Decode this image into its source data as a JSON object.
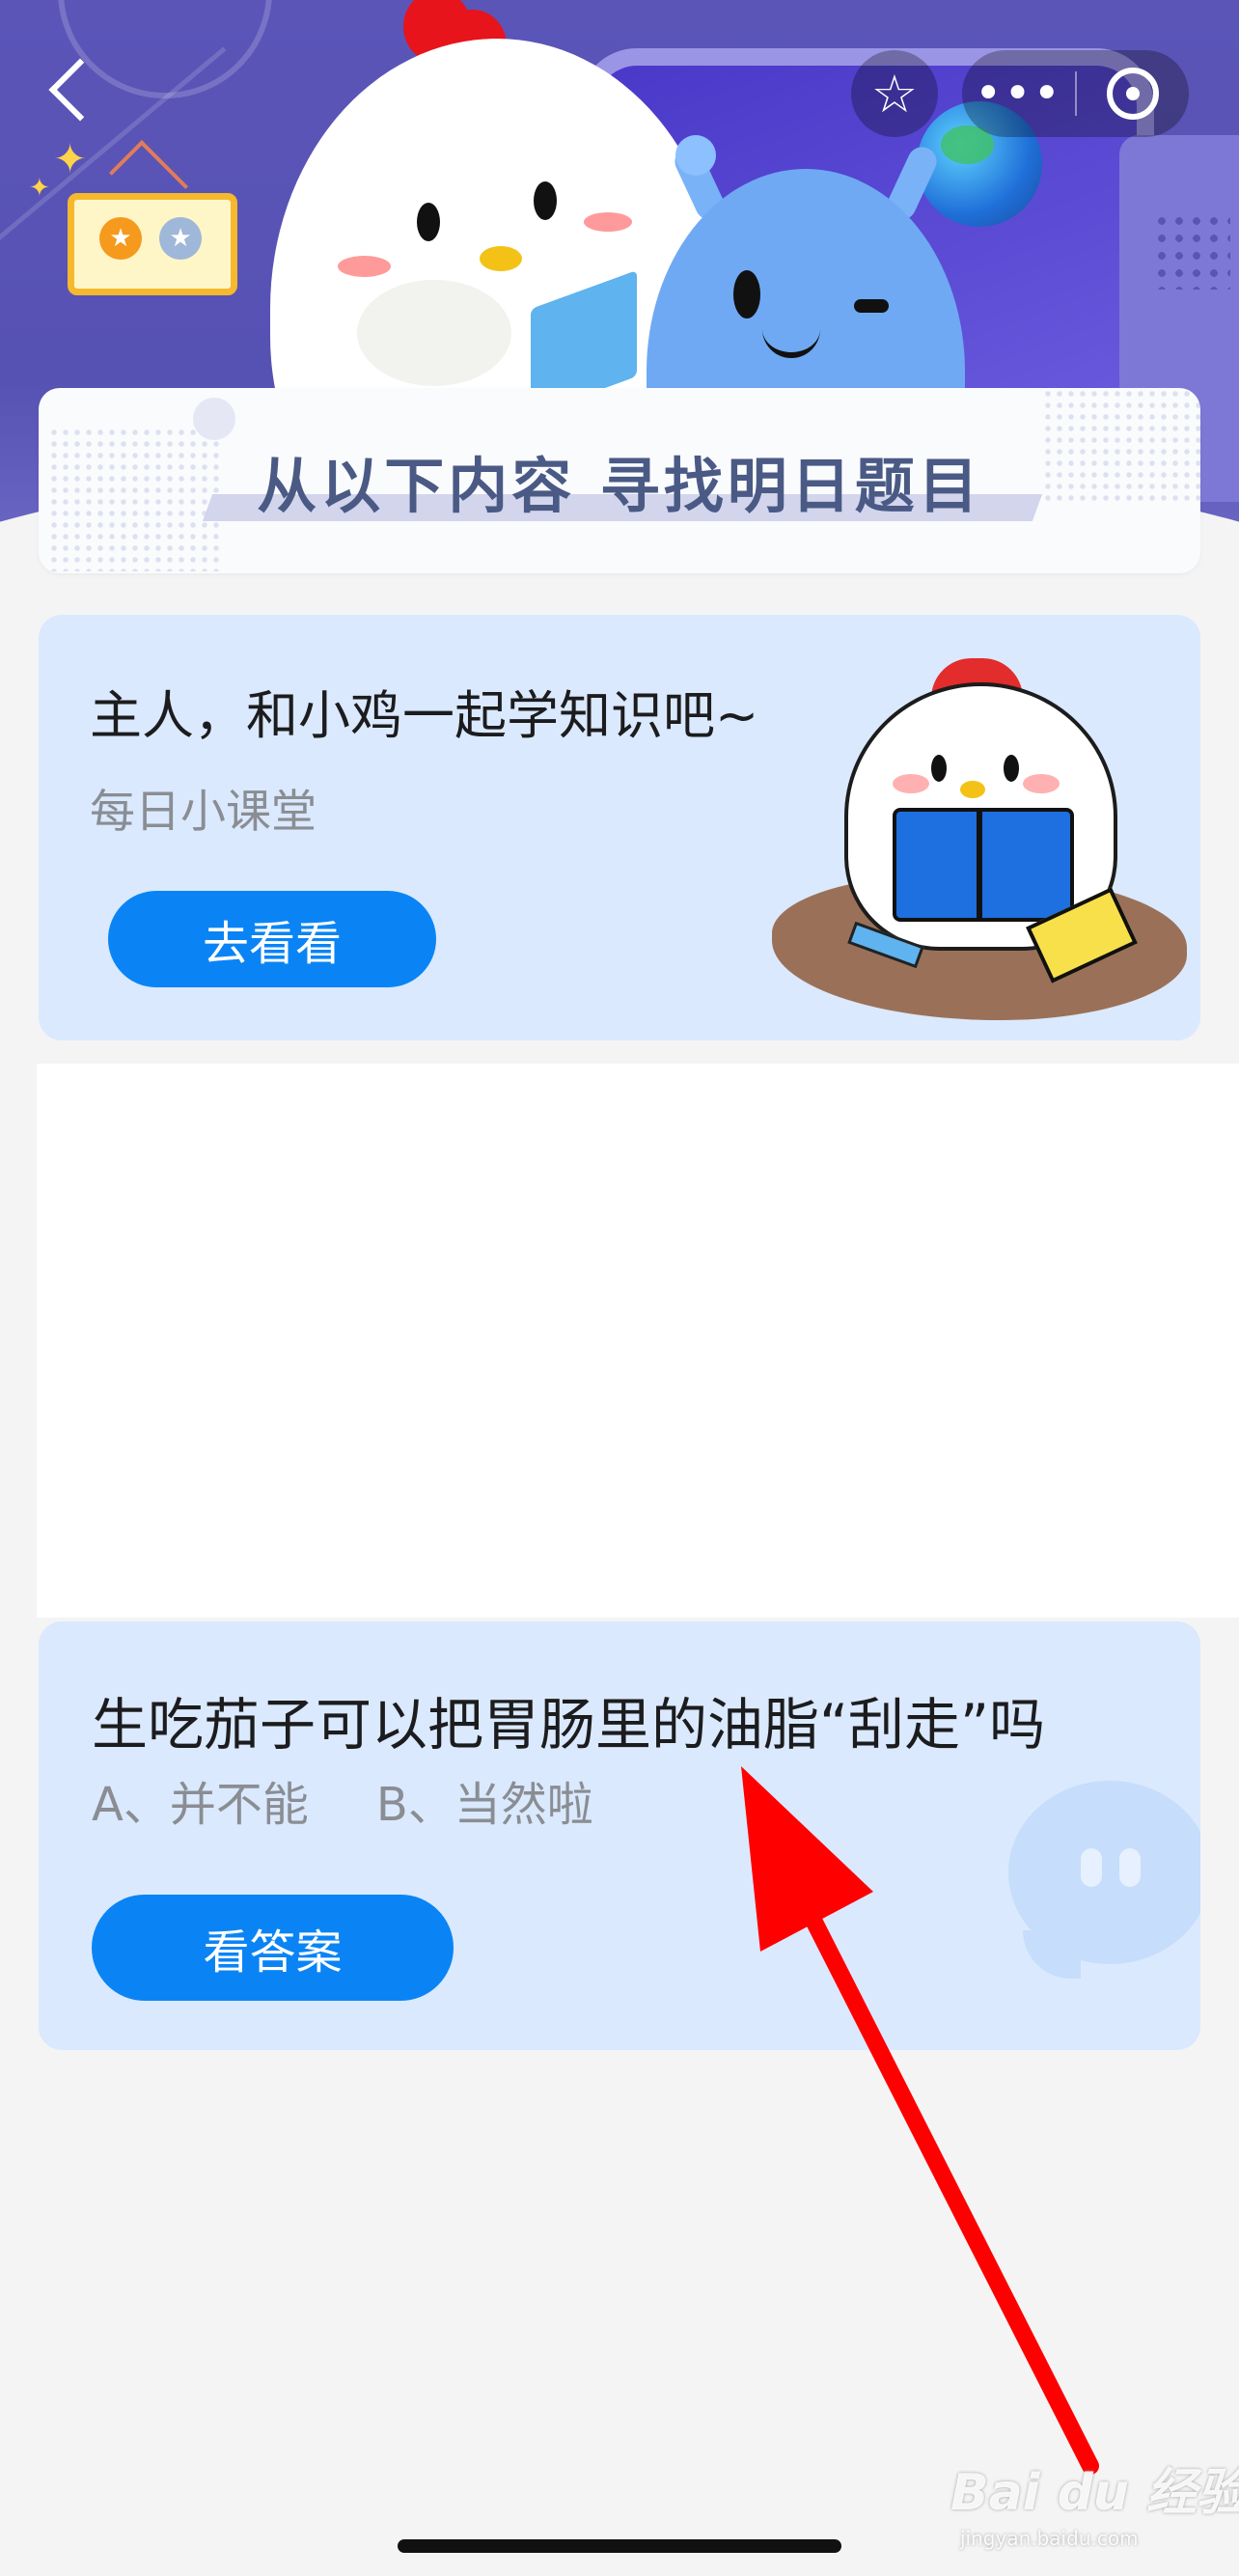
{
  "nav": {
    "back_icon": "chevron-left-icon",
    "star_icon": "star-icon",
    "more_icon": "more-dots-icon",
    "more_glyph": "•••",
    "close_icon": "target-circle-icon"
  },
  "banner": {
    "medal_icons": [
      "gold-medal-icon",
      "silver-medal-icon"
    ],
    "medal_glyph": "★"
  },
  "title_card": {
    "text": "从以下内容 寻找明日题目"
  },
  "learn_card": {
    "title": "主人，和小鸡一起学知识吧~",
    "subtitle": "每日小课堂",
    "button_label": "去看看"
  },
  "question_card": {
    "question": "生吃茄子可以把胃肠里的油脂“刮走”吗",
    "options": [
      "A、并不能",
      "B、当然啦"
    ],
    "button_label": "看答案"
  },
  "watermark": {
    "logo_text": "Bai du 经验",
    "url": "jingyan.baidu.com"
  },
  "colors": {
    "banner": "#5b55b8",
    "card_bg": "#dae9fd",
    "primary_button": "#0a84f5",
    "arrow": "#fe0000",
    "title_text": "#4a5a85"
  }
}
